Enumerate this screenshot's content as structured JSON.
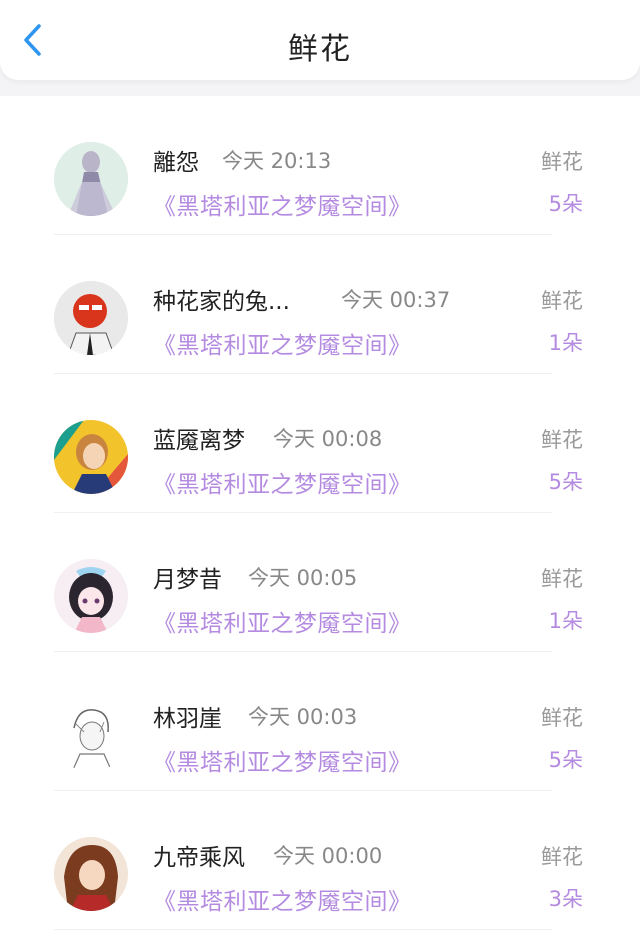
{
  "header": {
    "title": "鲜花"
  },
  "items": [
    {
      "name": "離怨",
      "time": "今天 20:13",
      "book": "《黑塔利亚之梦魇空间》",
      "gift_label": "鲜花",
      "gift_count": "5朵"
    },
    {
      "name": "种花家的兔...",
      "time": "今天 00:37",
      "book": "《黑塔利亚之梦魇空间》",
      "gift_label": "鲜花",
      "gift_count": "1朵"
    },
    {
      "name": "蓝魇离梦",
      "time": "今天 00:08",
      "book": "《黑塔利亚之梦魇空间》",
      "gift_label": "鲜花",
      "gift_count": "5朵"
    },
    {
      "name": "月梦昔",
      "time": "今天 00:05",
      "book": "《黑塔利亚之梦魇空间》",
      "gift_label": "鲜花",
      "gift_count": "1朵"
    },
    {
      "name": "林羽崖",
      "time": "今天 00:03",
      "book": "《黑塔利亚之梦魇空间》",
      "gift_label": "鲜花",
      "gift_count": "5朵"
    },
    {
      "name": "九帝乘风",
      "time": "今天 00:00",
      "book": "《黑塔利亚之梦魇空间》",
      "gift_label": "鲜花",
      "gift_count": "3朵"
    }
  ],
  "colors": {
    "accent": "#b48be0",
    "back_arrow": "#2f96f0"
  }
}
